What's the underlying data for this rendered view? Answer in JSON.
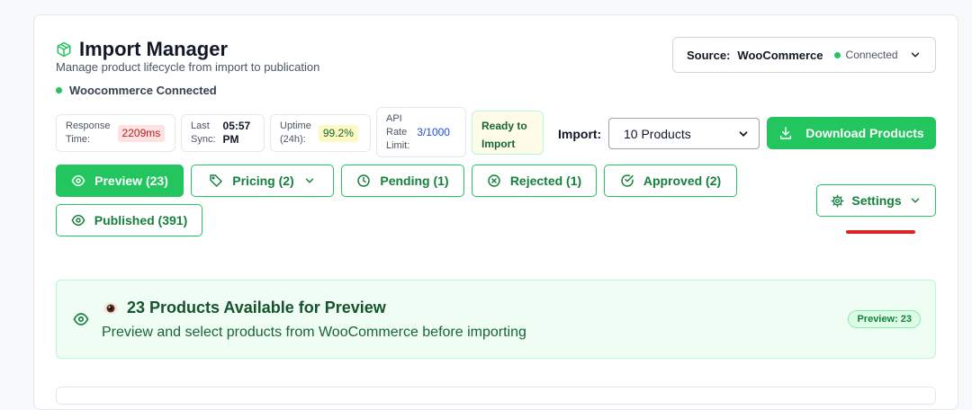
{
  "header": {
    "title": "Import Manager",
    "subtitle": "Manage product lifecycle from import to publication",
    "connection_status": "Woocommerce Connected"
  },
  "source": {
    "label": "Source:",
    "value": "WooCommerce",
    "status": "Connected"
  },
  "stats": {
    "response_time": {
      "label": "Response\nTime:",
      "value": "2209ms"
    },
    "last_sync": {
      "label": "Last\nSync:",
      "value": "05:57\nPM"
    },
    "uptime": {
      "label": "Uptime\n(24h):",
      "value": "99.2%"
    },
    "api_rate": {
      "label": "API\nRate\nLimit:",
      "value": "3/1000"
    },
    "ready": "Ready to Import"
  },
  "import": {
    "label": "Import:",
    "selected": "10 Products",
    "download_label": "Download Products"
  },
  "tabs": [
    {
      "label": "Preview (23)"
    },
    {
      "label": "Pricing (2)"
    },
    {
      "label": "Pending (1)"
    },
    {
      "label": "Rejected (1)"
    },
    {
      "label": "Approved (2)"
    },
    {
      "label": "Published (391)"
    }
  ],
  "settings_label": "Settings",
  "panel": {
    "title": "23 Products Available for Preview",
    "description": "Preview and select products from WooCommerce before importing",
    "badge": "Preview: 23"
  },
  "colors": {
    "accent": "#22c55e",
    "accent_dark": "#15803d",
    "alert": "#dc2626"
  }
}
